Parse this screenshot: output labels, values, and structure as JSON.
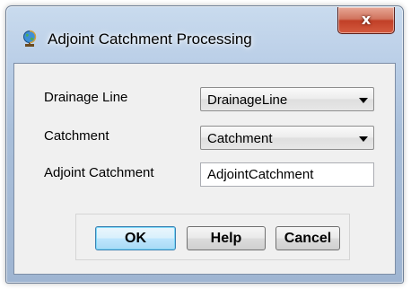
{
  "window": {
    "title": "Adjoint Catchment Processing",
    "icon": "globe-icon",
    "close_label": "x"
  },
  "form": {
    "drainage_line": {
      "label": "Drainage Line",
      "value": "DrainageLine"
    },
    "catchment": {
      "label": "Catchment",
      "value": "Catchment"
    },
    "adjoint_catchment": {
      "label": "Adjoint Catchment",
      "value": "AdjointCatchment"
    }
  },
  "buttons": {
    "ok": "OK",
    "help": "Help",
    "cancel": "Cancel"
  },
  "colors": {
    "close_button": "#c7432b",
    "default_button_border": "#3c7fb1",
    "dialog_background": "#f0f0f0"
  }
}
